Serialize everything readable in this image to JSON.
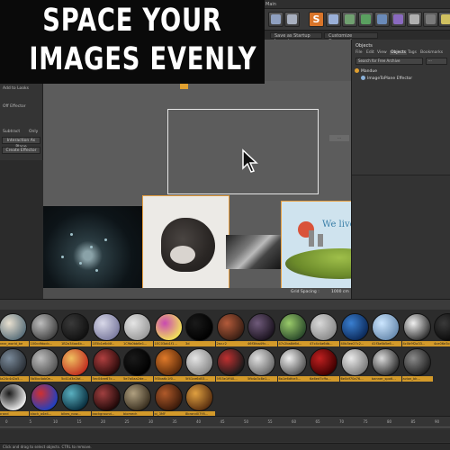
{
  "headline": {
    "line1": "SPACE YOUR",
    "line2": "IMAGES EVENLY"
  },
  "menubar": {
    "items": [
      "Main"
    ]
  },
  "toolbar": {
    "buttons": [
      "move-tool",
      "scale-tool",
      "rotate-tool",
      "s-tool",
      "cube-tool",
      "pen-tool",
      "subdivision-tool",
      "array-tool",
      "deformer-tool",
      "floor-tool",
      "camera-tool",
      "light-tool",
      "render-tool"
    ],
    "layout_tabs": [
      "Save as Startup Layout",
      "Customize Commands..."
    ]
  },
  "left_panel": {
    "rows": [
      "Add to Looks",
      "Off Effector",
      "Subtract",
      "Only"
    ],
    "buttons": [
      "Interaction As Plane",
      "Create Effector"
    ]
  },
  "viewport": {
    "grid_spacing_label": "Grid Spacing :",
    "grid_spacing_value": "1000 cm",
    "image_caption": "We live in"
  },
  "objects_panel": {
    "title": "Objects",
    "tabs": [
      "File",
      "Edit",
      "View",
      "Objects",
      "Tags",
      "Bookmarks"
    ],
    "active_tab": "Objects",
    "search_bar": "Search for Free Archive",
    "tree": [
      "Mandue",
      "ImageToPlane Effector"
    ]
  },
  "shelf": {
    "row1": [
      {
        "label": "hear_world_be",
        "colors": [
          "#e8e0d0",
          "#5a6f7a"
        ]
      },
      {
        "label": "100cdfdocb...",
        "colors": [
          "#bdbdbd",
          "#444444"
        ]
      },
      {
        "label": "1B2a34aa4b...",
        "colors": [
          "#3a3a3a",
          "#111111"
        ]
      },
      {
        "label": "1E5b1e6d4f...",
        "colors": [
          "#d8d8e8",
          "#7c7ca0"
        ]
      },
      {
        "label": "1C9b0bb6e1...",
        "colors": [
          "#e5e5e5",
          "#9a9a9a"
        ]
      },
      {
        "label": "1EC03ab1f1...",
        "colors": [
          "#c94ab0",
          "#f2e25a"
        ]
      },
      {
        "label": "3d",
        "colors": [
          "#1a1a1a",
          "#000000"
        ]
      },
      {
        "label": "2ez-r2",
        "colors": [
          "#b35a3a",
          "#3a1f14"
        ]
      },
      {
        "label": "46f3faa49c...",
        "colors": [
          "#6f5a7a",
          "#1c1420"
        ]
      },
      {
        "label": "47c2ba8d6d...",
        "colors": [
          "#9acb6a",
          "#2b4a2b"
        ]
      },
      {
        "label": "47c4c4a6db...",
        "colors": [
          "#d9d9d9",
          "#8a8a8a"
        ]
      },
      {
        "label": "40b3ee27c2...",
        "colors": [
          "#3a7fd0",
          "#0c2a5a"
        ]
      },
      {
        "label": "41f3a6b5e6...",
        "colors": [
          "#cce6ff",
          "#6a8cb0"
        ]
      },
      {
        "label": "4c0b9f2a33...",
        "colors": [
          "#f0f0f0",
          "#333333"
        ]
      },
      {
        "label": "4ce06e3ce2...",
        "colors": [
          "#3a3a3a",
          "#0a0a0a"
        ]
      }
    ],
    "row2": [
      {
        "label": "5a24c4d2a5...",
        "colors": [
          "#7a8a9a",
          "#2a2f35"
        ]
      },
      {
        "label": "5b5bc4ab0e...",
        "colors": [
          "#bcbcbc",
          "#555555"
        ]
      },
      {
        "label": "5c41d3e2bf...",
        "colors": [
          "#f0c060",
          "#c03020"
        ]
      },
      {
        "label": "5ec04ee67c...",
        "colors": [
          "#b04040",
          "#2a0a0a"
        ]
      },
      {
        "label": "5e7a0aa2de...",
        "colors": [
          "#1a1a1a",
          "#000000"
        ]
      },
      {
        "label": "5f3ba6c1f0...",
        "colors": [
          "#e07a2a",
          "#5a2a0a"
        ]
      },
      {
        "label": "5f41ce6d53...",
        "colors": [
          "#e5e5e5",
          "#888888"
        ]
      },
      {
        "label": "5f53e1ff40...",
        "colors": [
          "#c03030",
          "#1a1a1a"
        ]
      },
      {
        "label": "5fb4a3c8e1...",
        "colors": [
          "#e0e0e0",
          "#6a6a6a"
        ]
      },
      {
        "label": "6a1e6dfce5...",
        "colors": [
          "#f0f0f0",
          "#555555"
        ]
      },
      {
        "label": "6a6ed7cffa...",
        "colors": [
          "#c02020",
          "#400000"
        ]
      },
      {
        "label": "6e0df70a76...",
        "colors": [
          "#eaeaea",
          "#7a7a7a"
        ]
      },
      {
        "label": "banner_spotl...",
        "colors": [
          "#dadada",
          "#303030"
        ]
      },
      {
        "label": "avion_bk...",
        "colors": [
          "#8a8a8a",
          "#222222"
        ]
      }
    ],
    "row3": [
      {
        "label": "brand",
        "colors": [
          "#1a1a1a",
          "#efefef"
        ]
      },
      {
        "label": "black_a4e4...",
        "colors": [
          "#d03030",
          "#2040c0"
        ]
      },
      {
        "label": "bikes_now...",
        "colors": [
          "#5ab0c0",
          "#0a3040"
        ]
      },
      {
        "label": "background...",
        "colors": [
          "#a04040",
          "#200808"
        ]
      },
      {
        "label": "biomech",
        "colors": [
          "#b0a080",
          "#3a3020"
        ]
      },
      {
        "label": "bl_3MF",
        "colors": [
          "#b05a2a",
          "#3a1a0a"
        ]
      },
      {
        "label": "8brand0795...",
        "colors": [
          "#e0a040",
          "#5a3010"
        ]
      }
    ]
  },
  "timeline": {
    "ticks": [
      "0",
      "5",
      "10",
      "15",
      "20",
      "25",
      "30",
      "35",
      "40",
      "45",
      "50",
      "55",
      "60",
      "65",
      "70",
      "75",
      "80",
      "85",
      "90"
    ]
  },
  "status_bar": {
    "text": "Click and drag to select objects. CTRL to remove."
  }
}
